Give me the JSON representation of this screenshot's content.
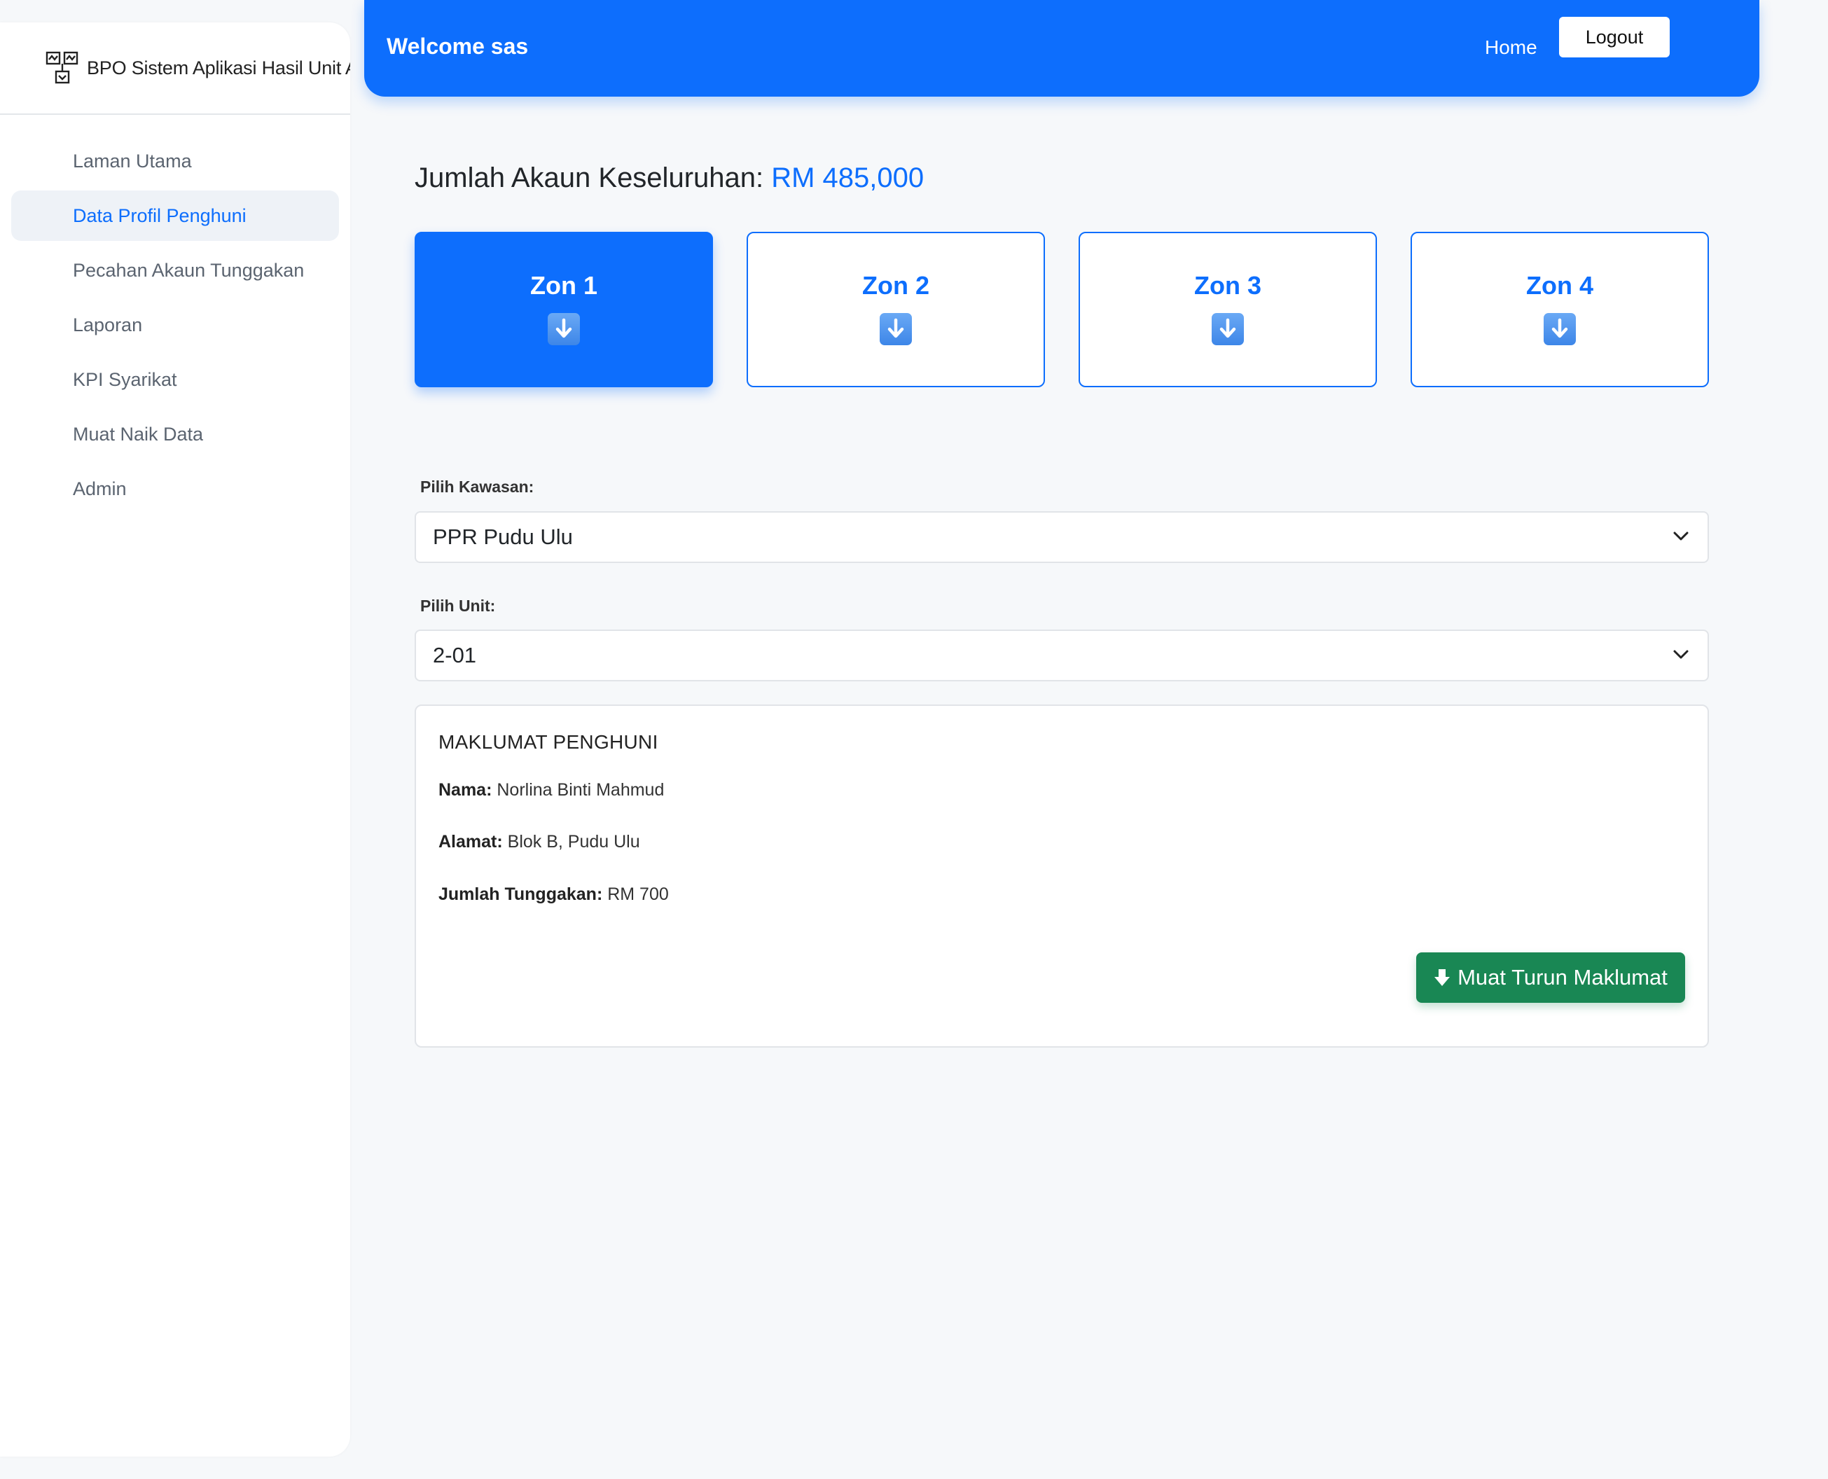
{
  "sidebar": {
    "brand_text": "BPO Sistem Aplikasi Hasil Unit A",
    "brand_icon": "sitemap-icon",
    "items": [
      {
        "label": "Laman Utama",
        "active": false
      },
      {
        "label": "Data Profil Penghuni",
        "active": true
      },
      {
        "label": "Pecahan Akaun Tunggakan",
        "active": false
      },
      {
        "label": "Laporan",
        "active": false
      },
      {
        "label": "KPI Syarikat",
        "active": false
      },
      {
        "label": "Muat Naik Data",
        "active": false
      },
      {
        "label": "Admin",
        "active": false
      }
    ]
  },
  "header": {
    "welcome": "Welcome sas",
    "home_label": "Home",
    "logout_label": "Logout"
  },
  "summary": {
    "label": "Jumlah Akaun Keseluruhan:",
    "amount": "RM 485,000"
  },
  "zones": [
    {
      "label": "Zon 1",
      "icon": "arrow-down-icon",
      "active": true
    },
    {
      "label": "Zon 2",
      "icon": "arrow-down-icon",
      "active": false
    },
    {
      "label": "Zon 3",
      "icon": "arrow-down-icon",
      "active": false
    },
    {
      "label": "Zon 4",
      "icon": "arrow-down-icon",
      "active": false
    }
  ],
  "filters": {
    "kawasan_label": "Pilih Kawasan:",
    "kawasan_value": "PPR Pudu Ulu",
    "unit_label": "Pilih Unit:",
    "unit_value": "2-01"
  },
  "info": {
    "title": "MAKLUMAT PENGHUNI",
    "nama_label": "Nama:",
    "nama_value": "Norlina Binti Mahmud",
    "alamat_label": "Alamat:",
    "alamat_value": "Blok B, Pudu Ulu",
    "tunggakan_label": "Jumlah Tunggakan:",
    "tunggakan_value": "RM 700",
    "download_label": "Muat Turun Maklumat"
  },
  "colors": {
    "primary": "#0d6efd",
    "success": "#198754",
    "background": "#f6f8fa"
  }
}
